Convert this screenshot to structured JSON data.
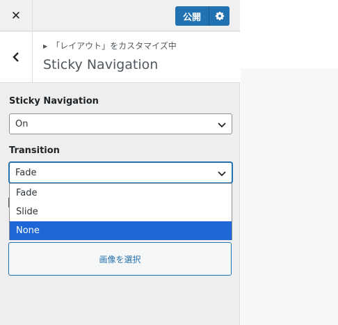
{
  "topbar": {
    "close_icon": "close-icon",
    "publish_label": "公開",
    "gear_icon": "gear-icon",
    "accent": "#2271b1"
  },
  "section": {
    "back_icon": "chevron-left-icon",
    "breadcrumb": "「レイアウト」をカスタマイズ中",
    "title": "Sticky Navigation"
  },
  "controls": {
    "sticky": {
      "label": "Sticky Navigation",
      "value": "On"
    },
    "transition": {
      "label": "Transition",
      "value": "Fade",
      "options": [
        "Fade",
        "Slide",
        "None"
      ],
      "highlighted": "None"
    },
    "image_button_label": "画像を選択"
  }
}
